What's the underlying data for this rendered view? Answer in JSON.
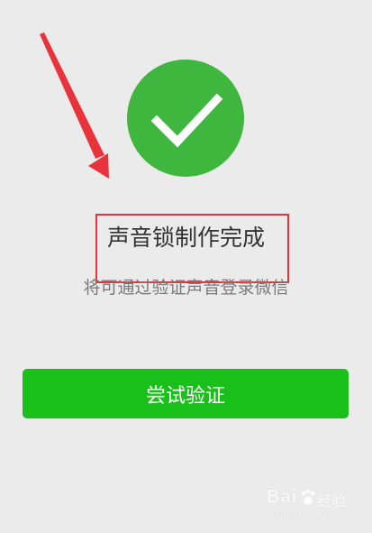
{
  "main": {
    "title": "声音锁制作完成",
    "subtitle": "将可通过验证声音登录微信",
    "button_label": "尝试验证"
  },
  "icons": {
    "success": "checkmark-icon",
    "annotation_arrow": "arrow-icon"
  },
  "watermark": {
    "brand": "Bai",
    "suffix": "经验",
    "url": "jingyan.baidu.com"
  },
  "colors": {
    "background": "#ebebeb",
    "success_green": "#3fb73f",
    "button_green": "#1ac01a",
    "annotation_red": "#e8333d"
  }
}
